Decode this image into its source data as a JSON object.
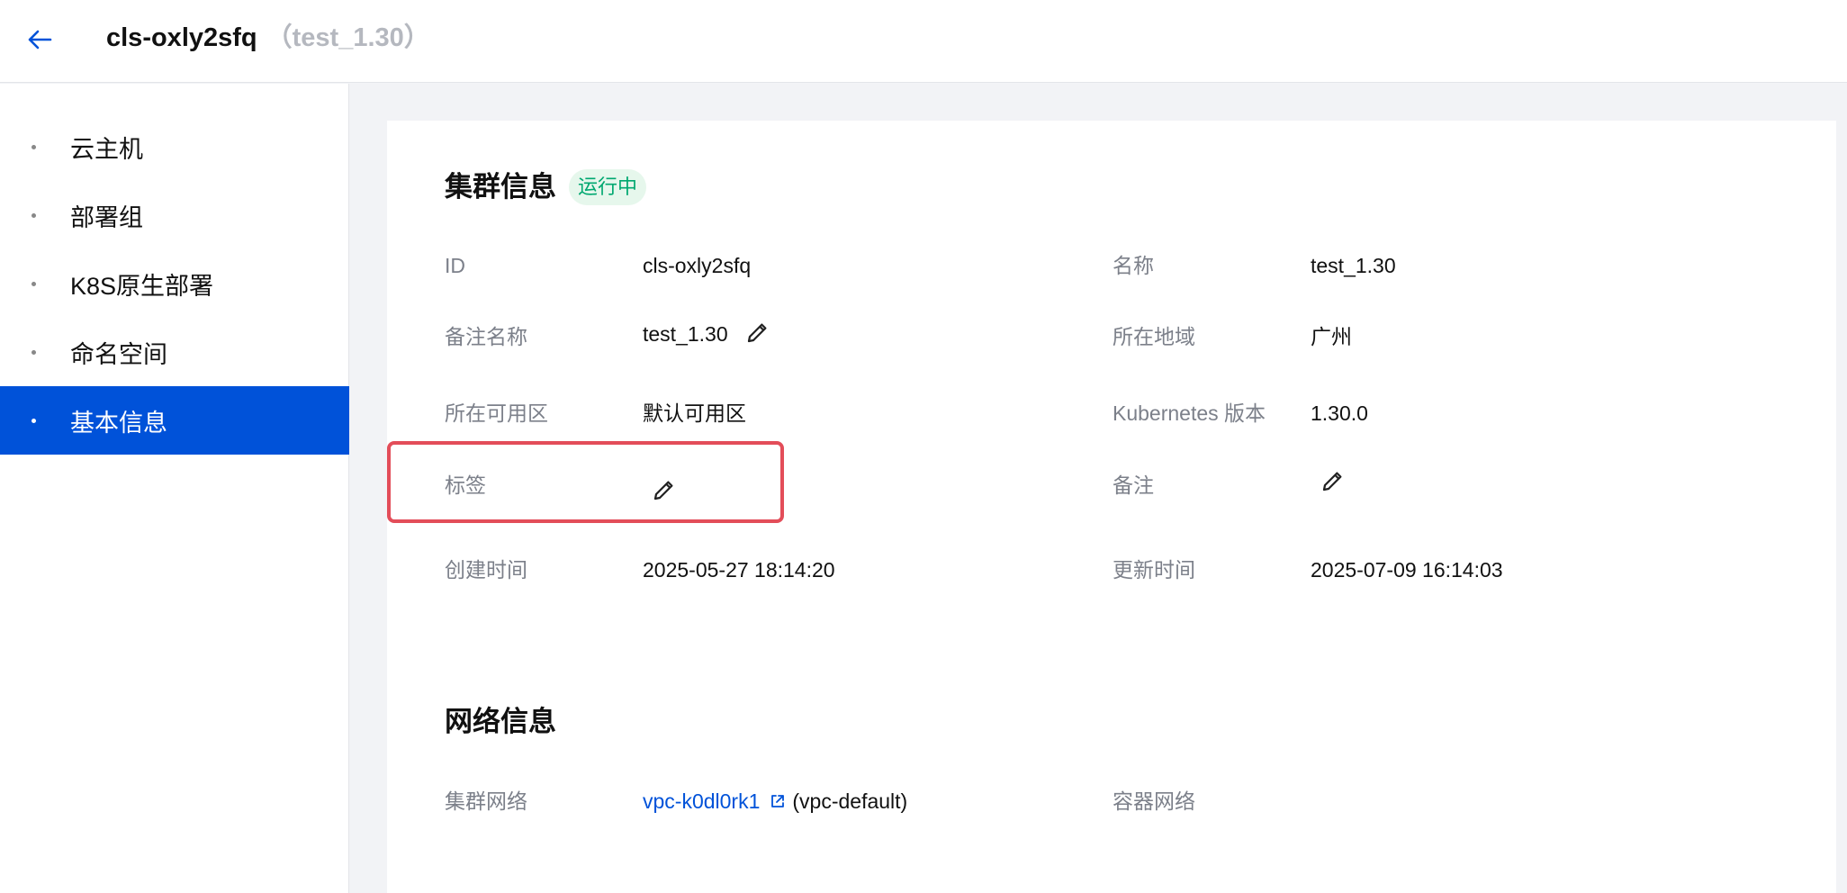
{
  "header": {
    "title": "cls-oxly2sfq",
    "subtitle": "（test_1.30）"
  },
  "sidebar": {
    "items": [
      {
        "label": "云主机",
        "active": false
      },
      {
        "label": "部署组",
        "active": false
      },
      {
        "label": "K8S原生部署",
        "active": false
      },
      {
        "label": "命名空间",
        "active": false
      },
      {
        "label": "基本信息",
        "active": true
      }
    ]
  },
  "cluster_info": {
    "title": "集群信息",
    "status": "运行中",
    "fields": {
      "id": {
        "label": "ID",
        "value": "cls-oxly2sfq"
      },
      "name": {
        "label": "名称",
        "value": "test_1.30"
      },
      "remark_name": {
        "label": "备注名称",
        "value": "test_1.30"
      },
      "region": {
        "label": "所在地域",
        "value": "广州"
      },
      "zone": {
        "label": "所在可用区",
        "value": "默认可用区"
      },
      "k8s_version": {
        "label": "Kubernetes 版本",
        "value": "1.30.0"
      },
      "tags": {
        "label": "标签",
        "value": ""
      },
      "remark": {
        "label": "备注",
        "value": ""
      },
      "created": {
        "label": "创建时间",
        "value": "2025-05-27 18:14:20"
      },
      "updated": {
        "label": "更新时间",
        "value": "2025-07-09 16:14:03"
      }
    }
  },
  "network_info": {
    "title": "网络信息",
    "fields": {
      "cluster_network": {
        "label": "集群网络",
        "link": "vpc-k0dl0rk1",
        "suffix": "(vpc-default)"
      },
      "container_network": {
        "label": "容器网络",
        "value": ""
      }
    }
  },
  "colors": {
    "accent": "#0052d9",
    "status_text": "#00a870",
    "status_bg": "#e6f7ec",
    "highlight": "#e34d59"
  },
  "icons": {
    "back": "arrow-left-icon",
    "edit": "pencil-icon",
    "external": "external-link-icon"
  }
}
